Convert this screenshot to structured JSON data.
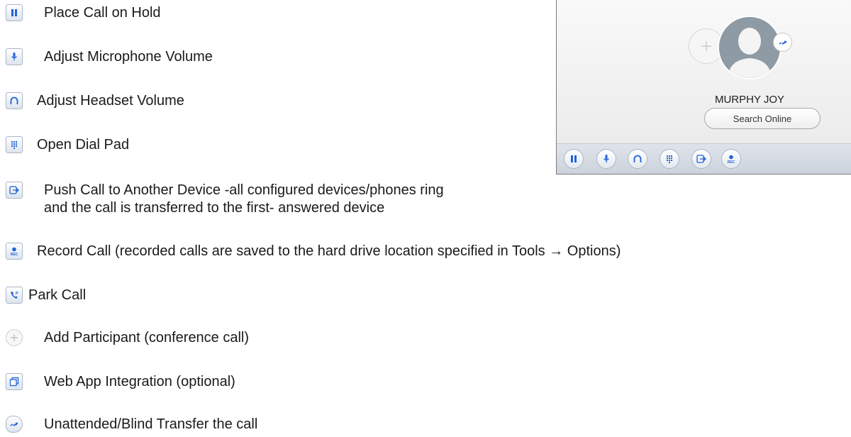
{
  "legend": [
    {
      "icon": "pause-icon",
      "label": "Place Call on Hold"
    },
    {
      "icon": "microphone-icon",
      "label": "Adjust Microphone Volume"
    },
    {
      "icon": "headset-icon",
      "label": "Adjust Headset Volume"
    },
    {
      "icon": "dial-pad-icon",
      "label": "Open Dial Pad"
    },
    {
      "icon": "push-call-icon",
      "label": "Push Call to Another Device -all configured devices/phones ring",
      "label_line2": "and the call is transferred to the first- answered device"
    },
    {
      "icon": "record-icon",
      "label": "Record Call (recorded calls are saved to the hard drive location specified in Tools → Options)"
    },
    {
      "icon": "park-call-icon",
      "label": "Park Call"
    },
    {
      "icon": "add-participant-icon",
      "label": "Add Participant (conference call)"
    },
    {
      "icon": "web-app-icon",
      "label": "Web App Integration (optional)"
    },
    {
      "icon": "blind-transfer-icon",
      "label": "Unattended/Blind Transfer the call"
    }
  ],
  "call_panel": {
    "contact_name": "MURPHY JOY",
    "search_online_label": "Search Online",
    "record_label": "REC",
    "toolbar": [
      "pause-icon",
      "microphone-icon",
      "headset-icon",
      "dial-pad-icon",
      "push-call-icon",
      "record-icon"
    ]
  },
  "colors": {
    "accent": "#1f63d6",
    "icon_border": "#a9b7c8",
    "panel_bg": "#efefef",
    "toolbar_bg": "#d6dce4"
  }
}
